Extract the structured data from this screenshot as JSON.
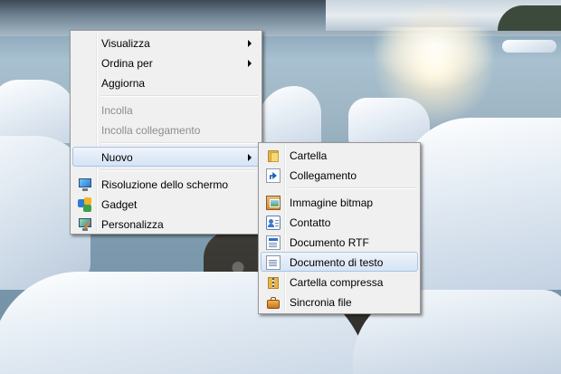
{
  "main_menu": {
    "items": [
      {
        "label": "Visualizza",
        "has_submenu": true
      },
      {
        "label": "Ordina per",
        "has_submenu": true
      },
      {
        "label": "Aggiorna"
      },
      {
        "label": "Incolla",
        "disabled": true
      },
      {
        "label": "Incolla collegamento",
        "disabled": true
      },
      {
        "label": "Nuovo",
        "has_submenu": true,
        "highlighted": true
      },
      {
        "label": "Risoluzione dello schermo",
        "icon": "monitor-icon"
      },
      {
        "label": "Gadget",
        "icon": "gadget-icon"
      },
      {
        "label": "Personalizza",
        "icon": "personalize-icon"
      }
    ]
  },
  "sub_menu": {
    "items": [
      {
        "label": "Cartella",
        "icon": "folder-icon"
      },
      {
        "label": "Collegamento",
        "icon": "shortcut-icon"
      },
      {
        "label": "Immagine bitmap",
        "icon": "bitmap-icon"
      },
      {
        "label": "Contatto",
        "icon": "contact-icon"
      },
      {
        "label": "Documento RTF",
        "icon": "rtf-document-icon"
      },
      {
        "label": "Documento di testo",
        "icon": "text-document-icon",
        "highlighted": true
      },
      {
        "label": "Cartella compressa",
        "icon": "zip-folder-icon"
      },
      {
        "label": "Sincronia file",
        "icon": "briefcase-icon"
      }
    ]
  },
  "colors": {
    "menu_background": "#f0f0f0",
    "menu_border": "#979797",
    "highlight_border": "#a8c4e6",
    "disabled_text": "#8d8d8d"
  }
}
